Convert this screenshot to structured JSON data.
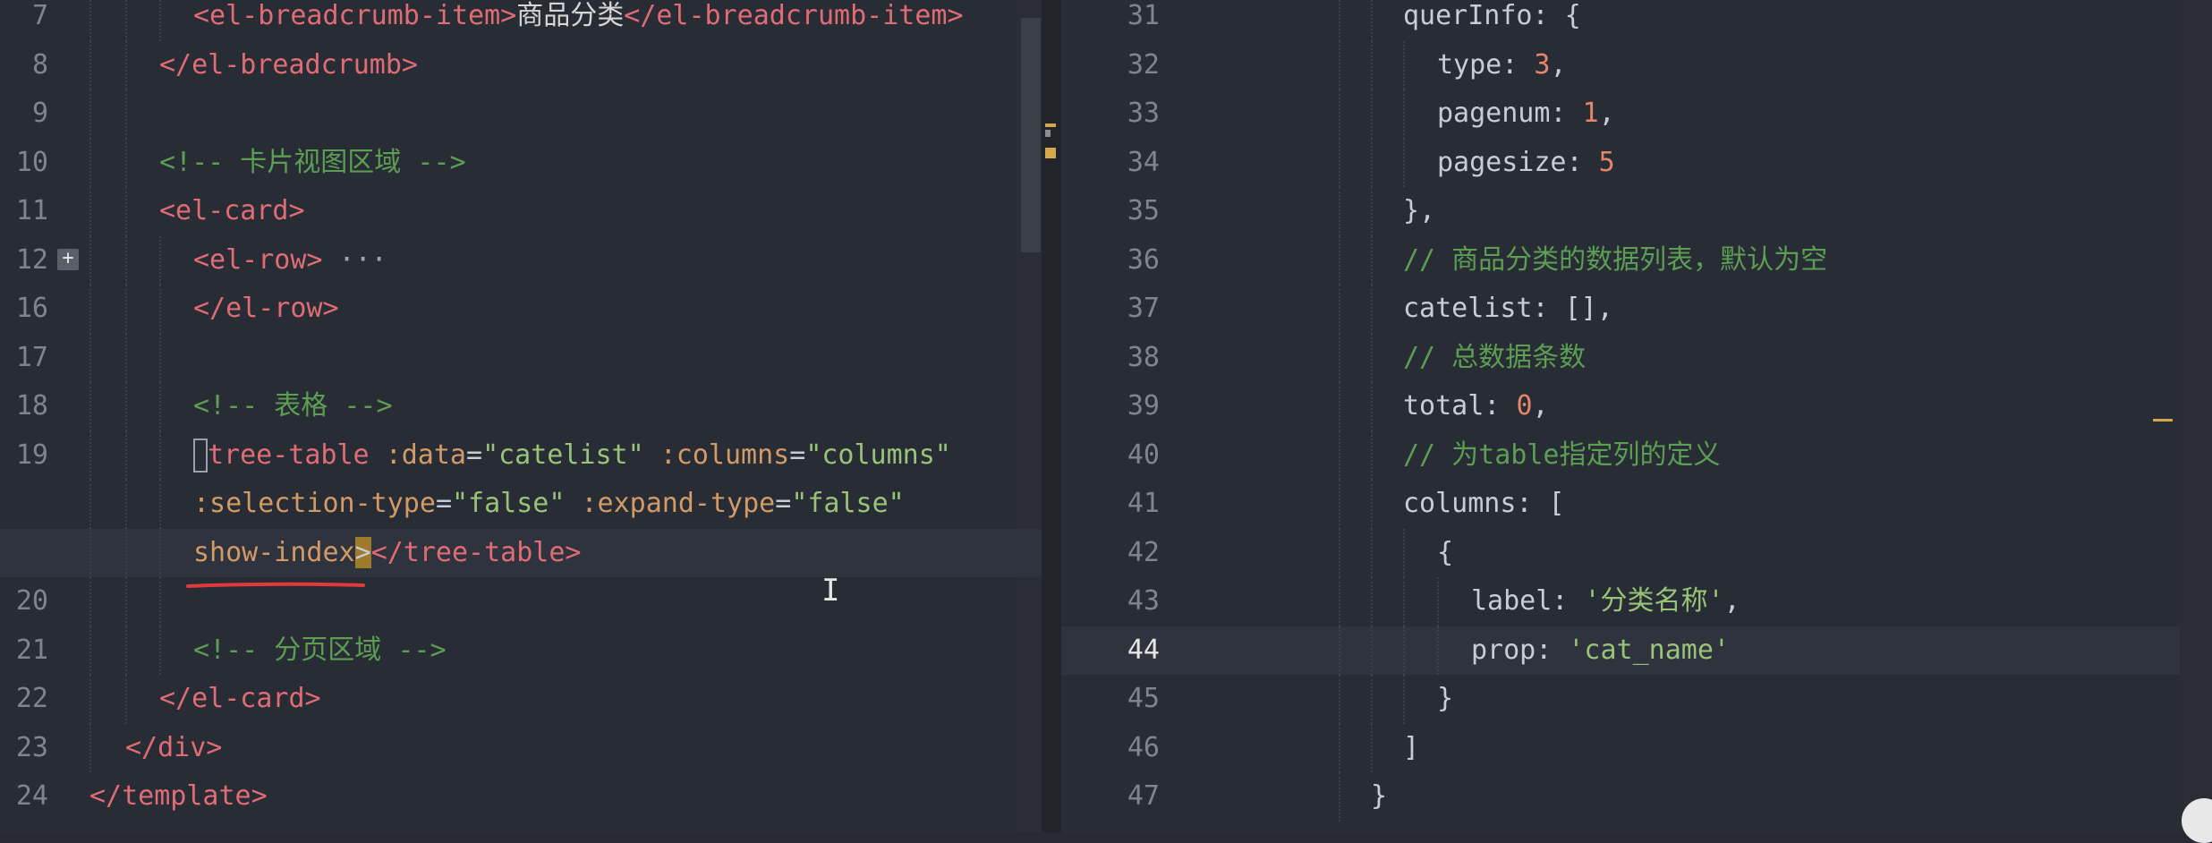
{
  "left_editor": {
    "lines": [
      {
        "no": "7",
        "parts": [
          [
            "tag",
            "<el-breadcrumb-item>"
          ],
          [
            "text",
            "商品分类"
          ],
          [
            "tag",
            "</el-breadcrumb-item>"
          ]
        ]
      },
      {
        "no": "8",
        "parts": [
          [
            "tag",
            "</el-breadcrumb>"
          ]
        ]
      },
      {
        "no": "9",
        "parts": []
      },
      {
        "no": "10",
        "parts": [
          [
            "comment",
            "<!-- 卡片视图区域 -->"
          ]
        ]
      },
      {
        "no": "11",
        "parts": [
          [
            "tag",
            "<el-card>"
          ]
        ]
      },
      {
        "no": "12",
        "parts": [
          [
            "tag",
            "<el-row>"
          ],
          [
            "fold",
            " ···"
          ]
        ]
      },
      {
        "no": "16",
        "parts": [
          [
            "tag",
            "</el-row>"
          ]
        ]
      },
      {
        "no": "17",
        "parts": []
      },
      {
        "no": "18",
        "parts": [
          [
            "comment",
            "<!-- 表格 -->"
          ]
        ]
      },
      {
        "no": "19",
        "parts": [
          [
            "tag",
            "tree-table "
          ],
          [
            "attr",
            ":data"
          ],
          [
            "punct",
            "="
          ],
          [
            "str",
            "\"catelist\""
          ],
          [
            "punct",
            " "
          ],
          [
            "attr",
            ":columns"
          ],
          [
            "punct",
            "="
          ],
          [
            "str",
            "\"columns\""
          ]
        ]
      },
      {
        "no": "",
        "parts": [
          [
            "attr",
            ":selection-type"
          ],
          [
            "punct",
            "="
          ],
          [
            "str",
            "\"false\""
          ],
          [
            "punct",
            " "
          ],
          [
            "attr",
            ":expand-type"
          ],
          [
            "punct",
            "="
          ],
          [
            "str",
            "\"false\""
          ]
        ]
      },
      {
        "no": "",
        "parts": [
          [
            "attr",
            "show-index"
          ],
          [
            "tag",
            "</tree-table>"
          ]
        ]
      },
      {
        "no": "20",
        "parts": []
      },
      {
        "no": "21",
        "parts": [
          [
            "comment",
            "<!-- 分页区域 -->"
          ]
        ]
      },
      {
        "no": "22",
        "parts": [
          [
            "tag",
            "</el-card>"
          ]
        ]
      },
      {
        "no": "23",
        "parts": [
          [
            "tag",
            "</div>"
          ]
        ]
      },
      {
        "no": "24",
        "parts": [
          [
            "tag",
            "</template>"
          ]
        ]
      }
    ],
    "fold_button": "+",
    "cursor_char": "I",
    "bracket_char": ">"
  },
  "right_editor": {
    "lines": [
      {
        "no": "31",
        "parts": [
          [
            "key",
            "querInfo: {"
          ]
        ]
      },
      {
        "no": "32",
        "parts": [
          [
            "key",
            "type: "
          ],
          [
            "num",
            "3"
          ],
          [
            "key",
            ","
          ]
        ]
      },
      {
        "no": "33",
        "parts": [
          [
            "key",
            "pagenum: "
          ],
          [
            "num",
            "1"
          ],
          [
            "key",
            ","
          ]
        ]
      },
      {
        "no": "34",
        "parts": [
          [
            "key",
            "pagesize: "
          ],
          [
            "num",
            "5"
          ]
        ]
      },
      {
        "no": "35",
        "parts": [
          [
            "key",
            "},"
          ]
        ]
      },
      {
        "no": "36",
        "parts": [
          [
            "comment",
            "// 商品分类的数据列表，默认为空"
          ]
        ]
      },
      {
        "no": "37",
        "parts": [
          [
            "key",
            "catelist: [],"
          ]
        ]
      },
      {
        "no": "38",
        "parts": [
          [
            "comment",
            "// 总数据条数"
          ]
        ]
      },
      {
        "no": "39",
        "parts": [
          [
            "key",
            "total: "
          ],
          [
            "num",
            "0"
          ],
          [
            "key",
            ","
          ]
        ]
      },
      {
        "no": "40",
        "parts": [
          [
            "comment",
            "// 为table指定列的定义"
          ]
        ]
      },
      {
        "no": "41",
        "parts": [
          [
            "key",
            "columns: ["
          ]
        ]
      },
      {
        "no": "42",
        "parts": [
          [
            "key",
            "{"
          ]
        ]
      },
      {
        "no": "43",
        "parts": [
          [
            "key",
            "label: "
          ],
          [
            "str",
            "'分类名称'"
          ],
          [
            "key",
            ","
          ]
        ]
      },
      {
        "no": "44",
        "parts": [
          [
            "key",
            "prop: "
          ],
          [
            "str",
            "'cat_name'"
          ]
        ]
      },
      {
        "no": "45",
        "parts": [
          [
            "key",
            "}"
          ]
        ]
      },
      {
        "no": "46",
        "parts": [
          [
            "key",
            "]"
          ]
        ]
      },
      {
        "no": "47",
        "parts": [
          [
            "key",
            "}"
          ]
        ]
      }
    ]
  },
  "colors": {
    "background": "#282c34",
    "tag": "#e06c75",
    "attr": "#d19a66",
    "string": "#98c379",
    "comment": "#5c9e54",
    "number": "#e5866b",
    "line_number": "#7f848e"
  }
}
